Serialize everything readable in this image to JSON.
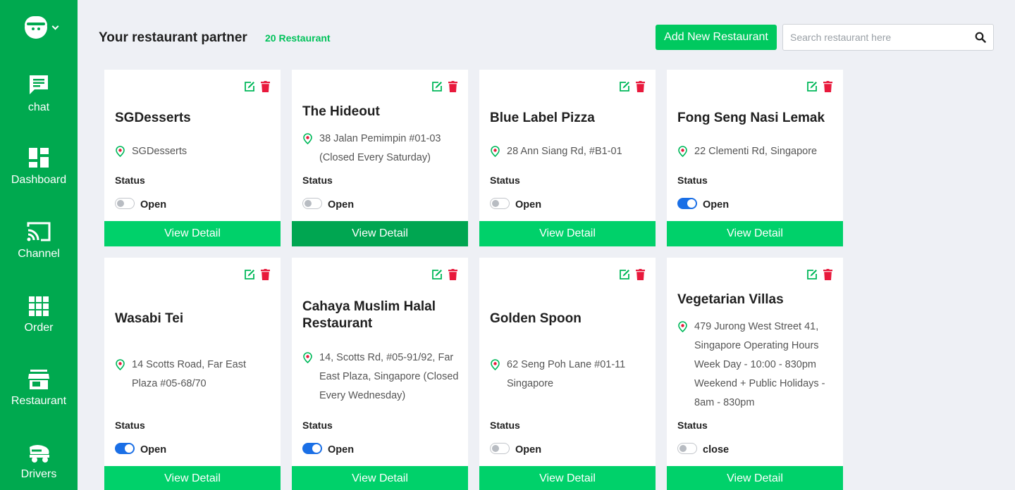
{
  "sidebar": {
    "items": [
      {
        "label": "chat",
        "icon": "chat-icon"
      },
      {
        "label": "Dashboard",
        "icon": "dashboard-icon"
      },
      {
        "label": "Channel",
        "icon": "cast-icon"
      },
      {
        "label": "Order",
        "icon": "grid-icon"
      },
      {
        "label": "Restaurant",
        "icon": "store-icon"
      },
      {
        "label": "Drivers",
        "icon": "delivery-icon"
      }
    ]
  },
  "header": {
    "title": "Your restaurant partner",
    "count": "20 Restaurant",
    "add_button": "Add New Restaurant",
    "search_placeholder": "Search restaurant here"
  },
  "labels": {
    "status": "Status",
    "view_detail": "View Detail"
  },
  "colors": {
    "brand_green": "#00a94f",
    "button_green": "#00d16a",
    "toggle_on": "#1a6fe6",
    "delete_red": "#e8193c"
  },
  "restaurants": [
    {
      "name": "SGDesserts",
      "address": "SGDesserts",
      "status": "Open",
      "enabled": false
    },
    {
      "name": "The Hideout",
      "address": "38 Jalan Pemimpin #01-03 (Closed Every Saturday)",
      "status": "Open",
      "enabled": false
    },
    {
      "name": "Blue Label Pizza",
      "address": "28 Ann Siang Rd, #B1-01",
      "status": "Open",
      "enabled": false
    },
    {
      "name": "Fong Seng Nasi Lemak",
      "address": "22 Clementi Rd, Singapore",
      "status": "Open",
      "enabled": true
    },
    {
      "name": "Wasabi Tei",
      "address": "14 Scotts Road, Far East Plaza #05-68/70",
      "status": "Open",
      "enabled": true
    },
    {
      "name": "Cahaya Muslim Halal Restaurant",
      "address": "14, Scotts Rd, #05-91/92, Far East Plaza, Singapore (Closed Every Wednesday)",
      "status": "Open",
      "enabled": true
    },
    {
      "name": "Golden Spoon",
      "address": "62 Seng Poh Lane #01-11 Singapore",
      "status": "Open",
      "enabled": false
    },
    {
      "name": "Vegetarian Villas",
      "address": "479 Jurong West Street 41, Singapore Operating Hours Week Day - 10:00 - 830pm Weekend + Public Holidays - 8am - 830pm",
      "status": "close",
      "enabled": false
    }
  ]
}
